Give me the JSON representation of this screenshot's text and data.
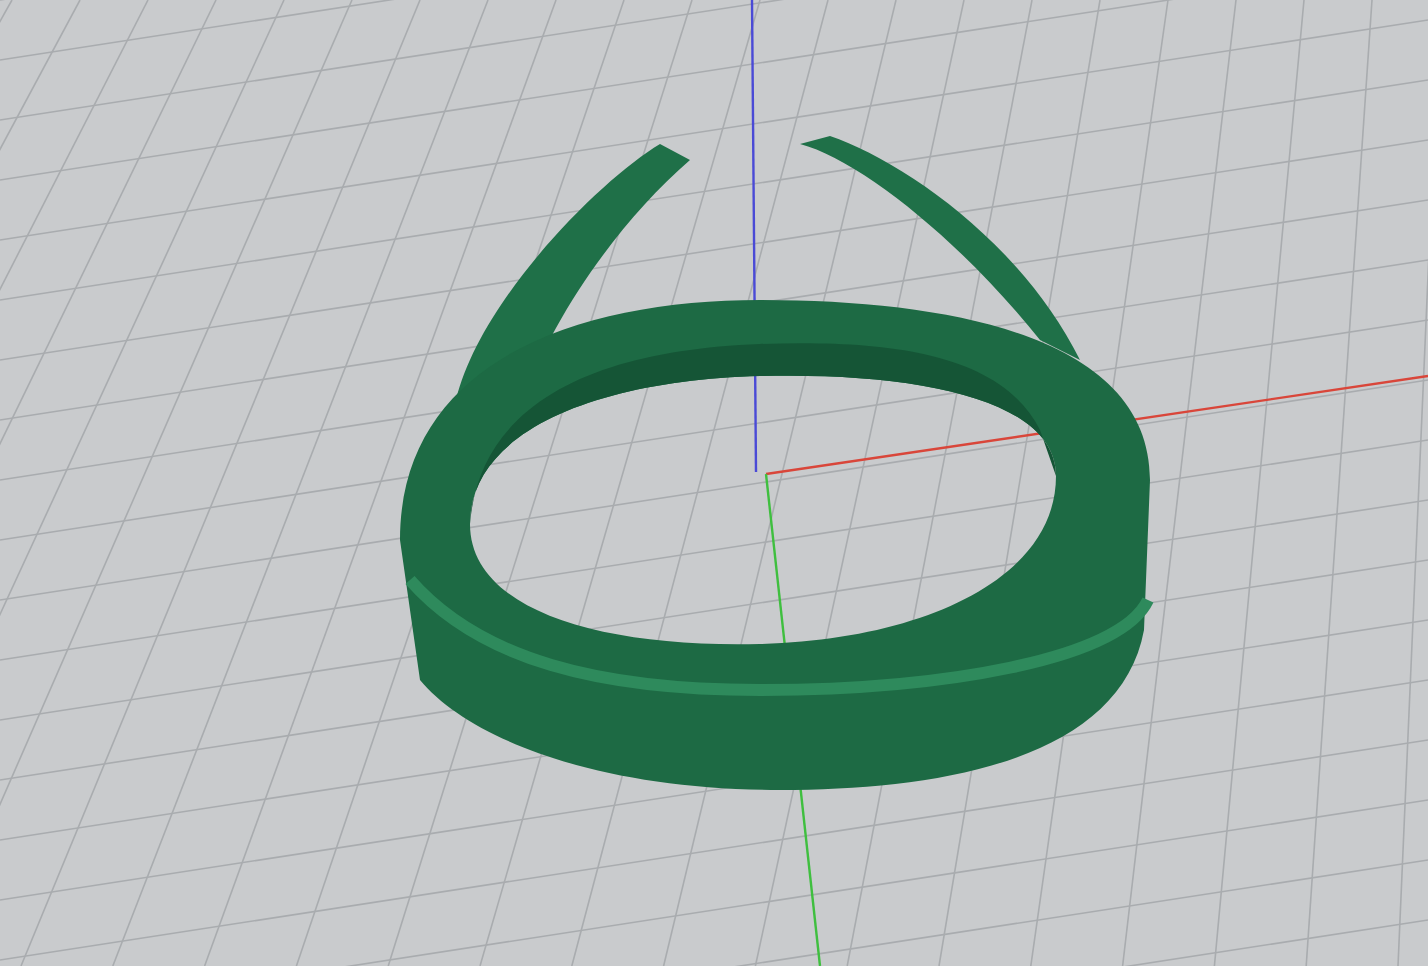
{
  "viewport": {
    "axes": [
      {
        "kind": "z",
        "color": "#4a4ad6"
      },
      {
        "kind": "x",
        "color": "#d9463a"
      },
      {
        "kind": "y",
        "color": "#3fbf3f"
      }
    ]
  }
}
